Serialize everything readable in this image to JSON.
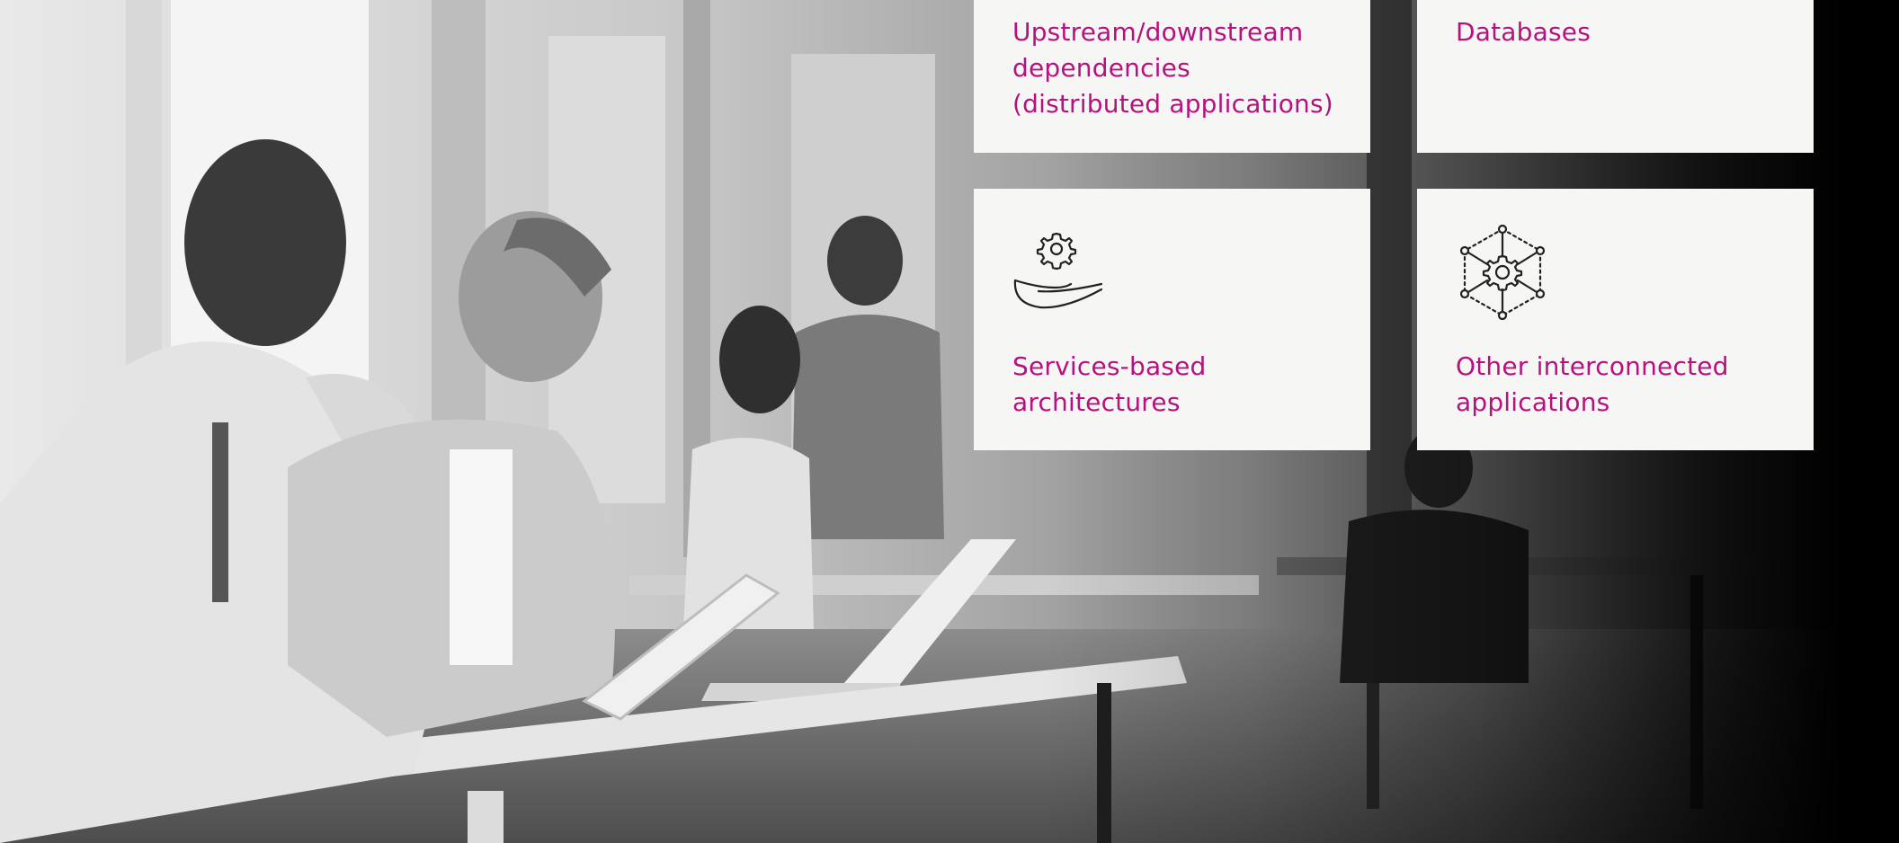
{
  "background": {
    "image": "office-coworkers-grayscale-photo",
    "overlay": "dark-gradient-right"
  },
  "cards": {
    "upstream": {
      "title": "Upstream/downstream\ndependencies\n(distributed applications)"
    },
    "databases": {
      "title": "Databases"
    },
    "services": {
      "title": "Services-based\narchitectures",
      "icon": "hand-gear-icon"
    },
    "other": {
      "title": "Other interconnected\napplications",
      "icon": "network-gear-icon"
    }
  },
  "colors": {
    "accent": "#b5127f",
    "card_bg": "#f6f6f4",
    "icon_stroke": "#222222"
  }
}
